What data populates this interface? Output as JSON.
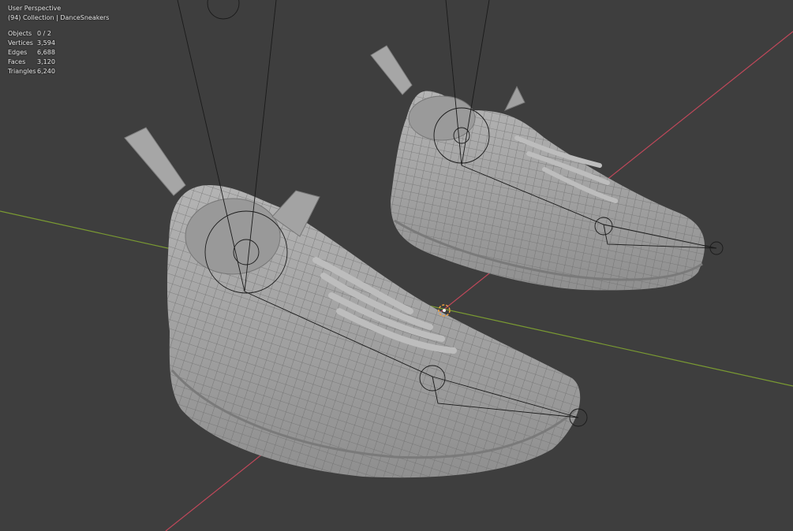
{
  "viewport": {
    "view_name": "User Perspective",
    "collection_line": "(94) Collection | DanceSneakers",
    "stats": [
      {
        "label": "Objects",
        "value": "0 / 2"
      },
      {
        "label": "Vertices",
        "value": "3,594"
      },
      {
        "label": "Edges",
        "value": "6,688"
      },
      {
        "label": "Faces",
        "value": "3,120"
      },
      {
        "label": "Triangles",
        "value": "6,240"
      }
    ]
  },
  "colors": {
    "background": "#3e3e3e",
    "mesh": "#a9a9a9",
    "wire": "#5f5f5f",
    "x_axis": "#c0485a",
    "y_axis": "#7a9a32",
    "origin": "#f0a040"
  }
}
